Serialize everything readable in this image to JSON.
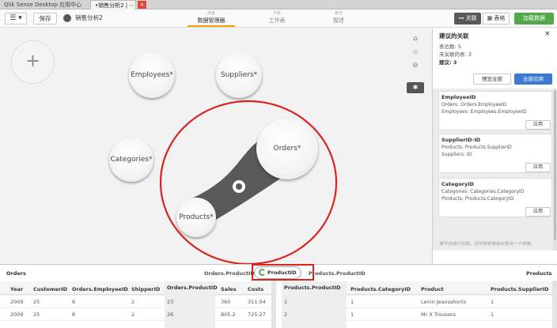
{
  "tabs": [
    {
      "label": "Qlik Sense Desktop 应用中心"
    },
    {
      "label": "•销售分析2 | ⋯"
    }
  ],
  "tab_close": "×",
  "toolbar": {
    "menu_label": "☰ ▾",
    "save_label": "保存",
    "app_name": "销售分析2",
    "nav": [
      {
        "small": "准备",
        "big": "数据管理器"
      },
      {
        "small": "分析",
        "big": "工作表"
      },
      {
        "small": "叙述",
        "big": "叙述"
      }
    ],
    "assoc_label": "关联",
    "table_label": "表格",
    "load_label": "加载数据"
  },
  "canvas": {
    "plus": "+",
    "tables": {
      "employees": "Employees*",
      "suppliers": "Suppliers*",
      "categories": "Categories*",
      "orders": "Orders*",
      "products": "Products*"
    },
    "tools": {
      "home": "⌂",
      "zoom_in": "⊕",
      "zoom_out": "⊖",
      "magic": "✱"
    }
  },
  "panel": {
    "title": "建议的关联",
    "close": "×",
    "stats": [
      "表总数: 5",
      "未关联的表: 3",
      "建议: 3"
    ],
    "preview_all": "预览全部",
    "apply_all": "全部应用",
    "suggestions": [
      {
        "title": "EmployeeID",
        "lines": [
          "Orders: Orders.EmployeeID",
          "Employees: Employees.EmployeeID"
        ],
        "apply": "应用"
      },
      {
        "title": "SupplierID-ID",
        "lines": [
          "Products: Products.SupplierID",
          "Suppliers: ID"
        ],
        "apply": "应用"
      },
      {
        "title": "CategoryID",
        "lines": [
          "Categories: Categories.CategoryID",
          "Products: Products.CategoryID"
        ],
        "apply": "应用"
      }
    ],
    "hint": "要手动进行关联，您可将表格拖动至另一个表格。"
  },
  "preview": {
    "left_table": "Orders",
    "left_key": "Orders.ProductID",
    "key": "ProductID",
    "right_key": "Products.ProductID",
    "right_table": "Products",
    "left_columns": [
      "Year",
      "CustomerID",
      "Orders.EmployeeID",
      "ShipperID",
      "Orders.ProductID",
      "Sales",
      "Costs"
    ],
    "left_rows": [
      [
        "2009",
        "25",
        "8",
        "2",
        "23",
        "360",
        "311.04"
      ],
      [
        "2009",
        "25",
        "8",
        "2",
        "26",
        "805.2",
        "725.27"
      ]
    ],
    "right_columns": [
      "Products.ProductID",
      "Products.CategoryID",
      "Product",
      "Products.SupplierID"
    ],
    "right_rows": [
      [
        "1",
        "1",
        "Lenin Jeansshorts",
        "1"
      ],
      [
        "2",
        "1",
        "Mr X Trousers",
        "1"
      ]
    ]
  },
  "colors": {
    "accent": "#f0a000",
    "load": "#52a84b",
    "apply_all": "#3b7ad3",
    "highlight": "#d9231f",
    "link": "#595959"
  }
}
